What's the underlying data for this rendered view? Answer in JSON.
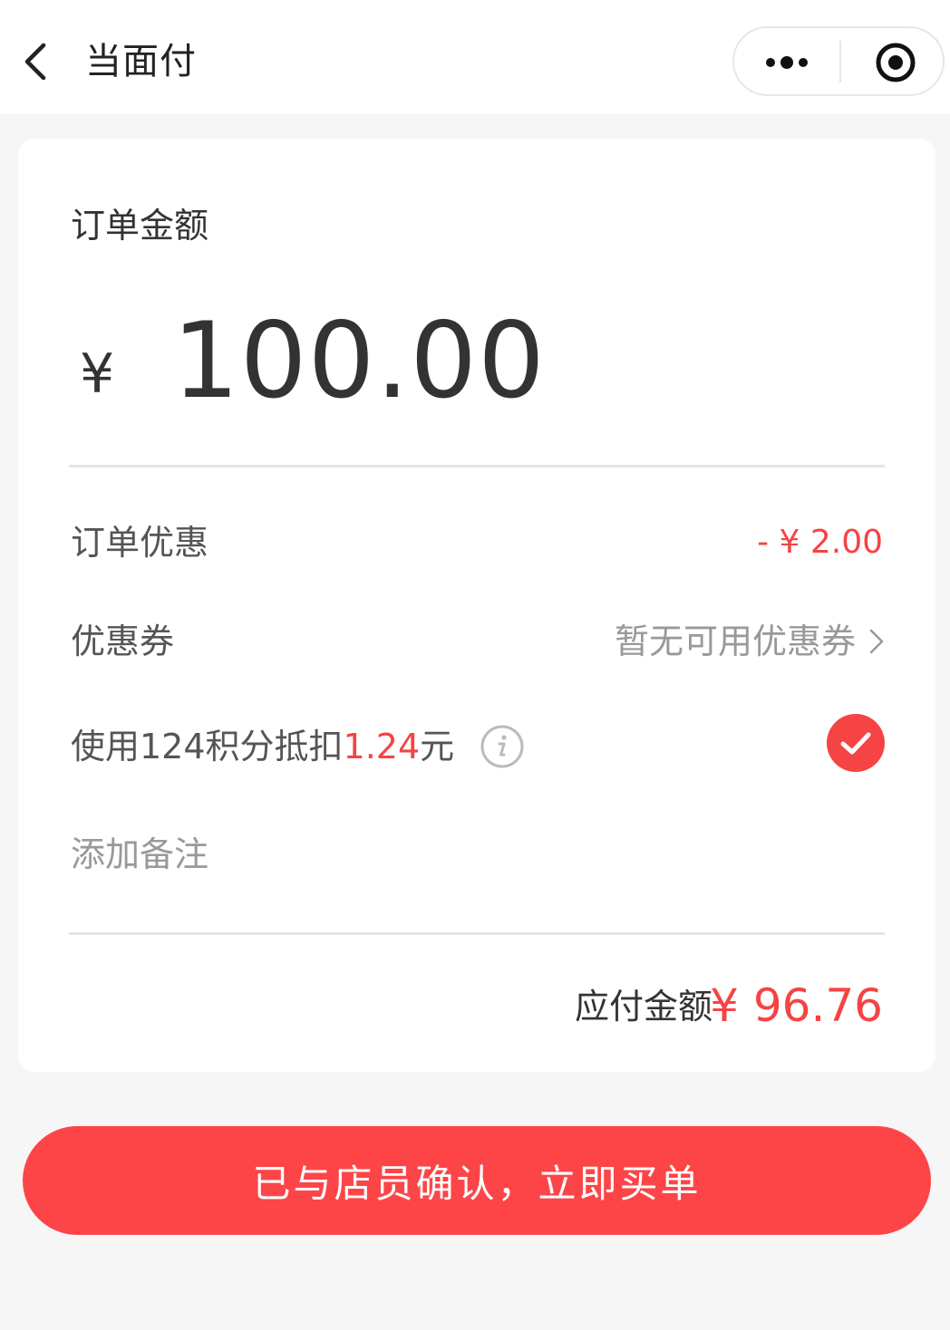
{
  "nav": {
    "title": "当面付",
    "back_icon": "chevron-left-icon",
    "more_icon": "more-dots-icon",
    "close_icon": "target-close-icon"
  },
  "order": {
    "label": "订单金额",
    "currency": "¥",
    "amount": "100.00"
  },
  "rows": {
    "discount_label": "订单优惠",
    "discount_value": "- ¥ 2.00",
    "coupon_label": "优惠券",
    "coupon_value": "暂无可用优惠券",
    "points_prefix": "使用124积分抵扣",
    "points_amount": "1.24",
    "points_suffix": "元",
    "points_checked": true,
    "remark_placeholder": "添加备注"
  },
  "total": {
    "label": "应付金额",
    "value": "¥ 96.76"
  },
  "button": {
    "pay_label": "已与店员确认，立即买单"
  },
  "colors": {
    "accent_red": "#f64344",
    "button_red": "#fd4548",
    "background": "#f6f6f6"
  }
}
